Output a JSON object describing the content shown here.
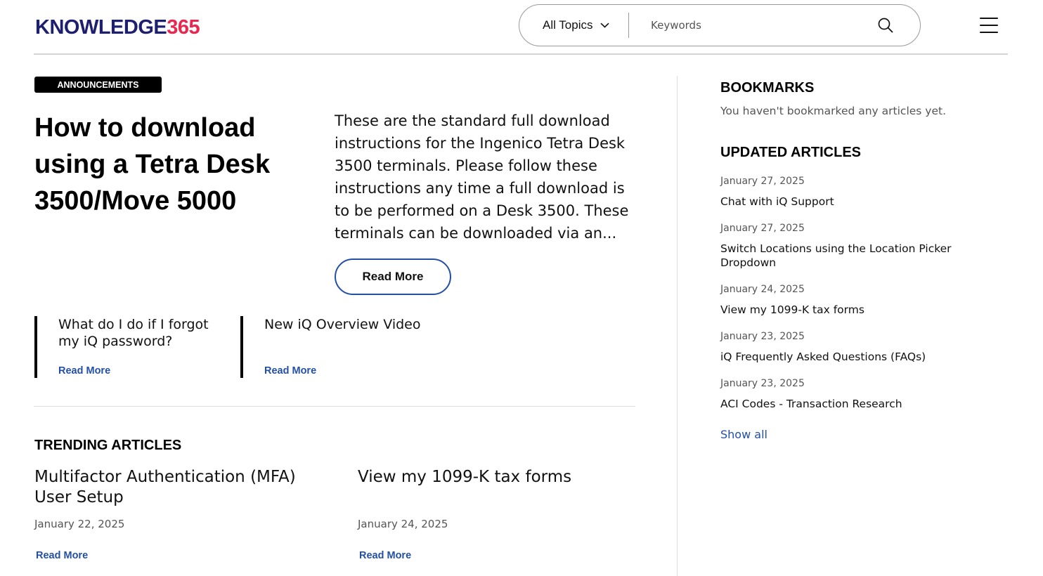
{
  "header": {
    "logo_part1": "KNOWLEDGE",
    "logo_part2": "365",
    "topic_select": "All Topics",
    "search_placeholder": "Keywords"
  },
  "featured": {
    "badge": "ANNOUNCEMENTS",
    "title": "How to download using a Tetra Desk 3500/Move 5000",
    "description": "These are the standard full download instructions for the Ingenico Tetra Desk 3500 terminals. Please follow these instructions any time a full download is to be performed on a Desk 3500. These terminals can be downloaded via an...",
    "read_more": "Read More"
  },
  "sub_articles": [
    {
      "title": "What do I do if I forgot my iQ password?",
      "read_more": "Read More"
    },
    {
      "title": "New iQ Overview Video",
      "read_more": "Read More"
    }
  ],
  "trending": {
    "heading": "TRENDING ARTICLES",
    "items": [
      {
        "title": "Multifactor Authentication (MFA) User Setup",
        "date": "January 22, 2025",
        "read_more": "Read More"
      },
      {
        "title": "View my 1099-K tax forms",
        "date": "January 24, 2025",
        "read_more": "Read More"
      }
    ]
  },
  "sidebar": {
    "bookmarks_heading": "BOOKMARKS",
    "bookmarks_empty": "You haven't bookmarked any articles yet.",
    "updated_heading": "UPDATED ARTICLES",
    "updated": [
      {
        "date": "January 27, 2025",
        "title": "Chat with iQ Support"
      },
      {
        "date": "January 27, 2025",
        "title": "Switch Locations using the Location Picker Dropdown"
      },
      {
        "date": "January 24, 2025",
        "title": "View my 1099-K tax forms"
      },
      {
        "date": "January 23, 2025",
        "title": "iQ Frequently Asked Questions (FAQs)"
      },
      {
        "date": "January 23, 2025",
        "title": "ACI Codes - Transaction Research"
      }
    ],
    "show_all": "Show all"
  },
  "colors": {
    "brand_navy": "#1e1f6e",
    "brand_red": "#e8284f",
    "link_blue": "#234fa5"
  }
}
